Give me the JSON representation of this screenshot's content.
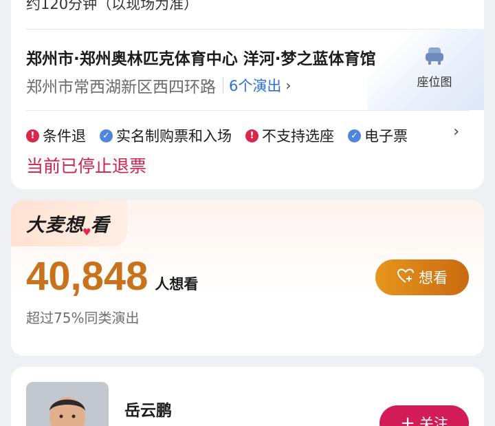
{
  "venue": {
    "duration_text": "约120分钟（以现场为准）",
    "name": "郑州市·郑州奥林匹克体育中心 洋河·梦之蓝体育馆",
    "address": "郑州市常西湖新区西四环路",
    "shows_link": "6个演出",
    "seat_map_label": "座位图",
    "seat_map_icon": "seat-icon",
    "tags": [
      {
        "icon": "warn",
        "glyph": "!",
        "label": "条件退"
      },
      {
        "icon": "ok",
        "glyph": "✓",
        "label": "实名制购票和入场"
      },
      {
        "icon": "warn",
        "glyph": "!",
        "label": "不支持选座"
      },
      {
        "icon": "ok",
        "glyph": "✓",
        "label": "电子票"
      }
    ],
    "refund_status": "当前已停止退票"
  },
  "want": {
    "badge_part1": "大麦想",
    "badge_part2": "看",
    "count": "40,848",
    "count_unit": "人想看",
    "compare": "超过75%同类演出",
    "button_label": "想看",
    "accent": "#c8721c"
  },
  "artist": {
    "name": "岳云鹏",
    "follow_label": "关注",
    "follow_color": "#d21c57"
  }
}
